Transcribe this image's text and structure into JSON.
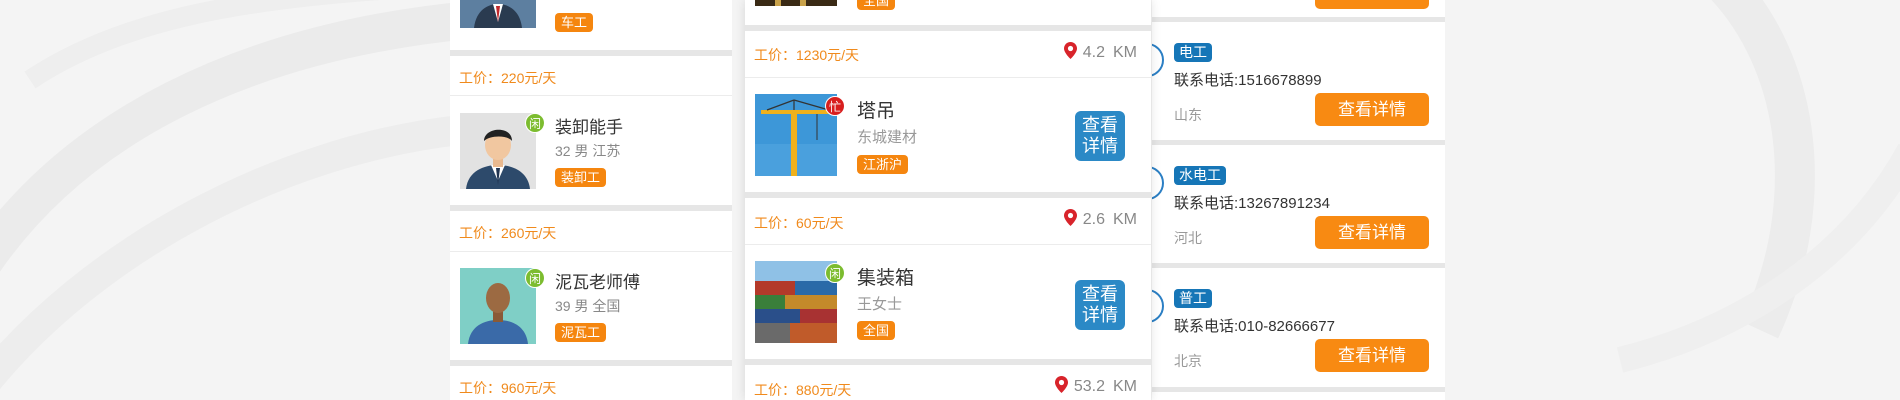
{
  "left": {
    "first_tag": "车工",
    "items": [
      {
        "price": "工价：220元/天",
        "name": "装卸能手",
        "status": "闲",
        "meta": "32  男  江苏",
        "tag": "装卸工"
      },
      {
        "price": "工价：260元/天",
        "name": "泥瓦老师傅",
        "status": "闲",
        "meta": "39  男  全国",
        "tag": "泥瓦工"
      }
    ],
    "last_price": "工价：960元/天"
  },
  "center": {
    "top_tag": "全国",
    "btn_label": "查看详情",
    "unit": "KM",
    "items": [
      {
        "price": "工价：1230元/天",
        "distance": "4.2",
        "title": "塔吊",
        "status": "忙",
        "sub": "东城建材",
        "tag": "江浙沪"
      },
      {
        "price": "工价：60元/天",
        "distance": "2.6",
        "title": "集装箱",
        "status": "闲",
        "sub": "王女士",
        "tag": "全国"
      }
    ],
    "last_price": "工价：880元/天",
    "last_distance": "53.2"
  },
  "right": {
    "btn_label": "查看详情",
    "items": [
      {
        "category": "电工",
        "phone": "联系电话:1516678899",
        "region": "山东"
      },
      {
        "category": "水电工",
        "phone": "联系电话:13267891234",
        "region": "河北"
      },
      {
        "category": "普工",
        "phone": "联系电话:010-82666677",
        "region": "北京"
      }
    ]
  },
  "colors": {
    "price_orange": "#f08a1c",
    "tag_orange": "#f5860f",
    "detail_blue": "#2b89c6",
    "category_blue": "#1676b7",
    "idle_green": "#7cbc2f",
    "busy_red": "#d81e1e",
    "pin_red": "#d8242b"
  },
  "icons": [
    "location-pin-icon",
    "worker-avatar",
    "tower-crane-photo",
    "container-photo"
  ]
}
